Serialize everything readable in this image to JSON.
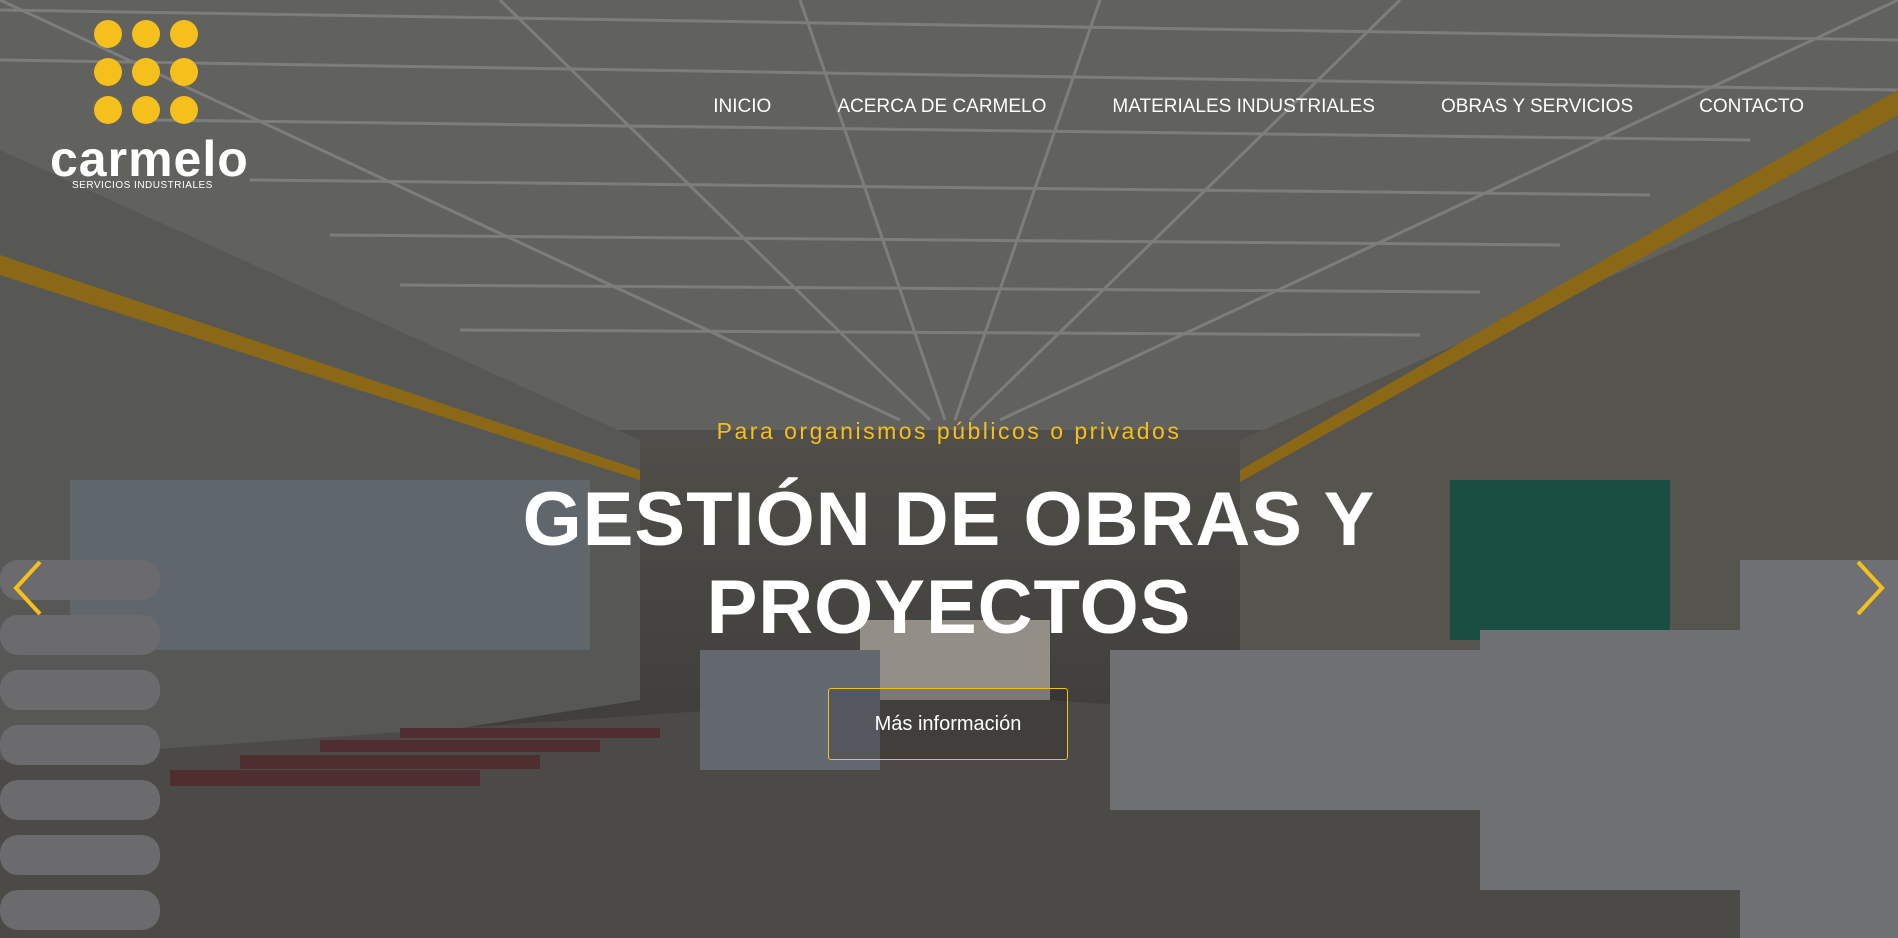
{
  "brand": {
    "name": "carmelo",
    "tagline": "SERVICIOS INDUSTRIALES",
    "accent": "#f5bf1c"
  },
  "nav": [
    {
      "label": "INICIO"
    },
    {
      "label": "ACERCA DE CARMELO"
    },
    {
      "label": "MATERIALES INDUSTRIALES"
    },
    {
      "label": "OBRAS Y SERVICIOS"
    },
    {
      "label": "CONTACTO"
    }
  ],
  "hero": {
    "subtitle": "Para organismos públicos o privados",
    "title_line1": "GESTIÓN DE OBRAS Y",
    "title_line2": "PROYECTOS",
    "cta_label": "Más información",
    "prev_icon": "chevron-left-icon",
    "next_icon": "chevron-right-icon",
    "background": "industrial-warehouse-photo"
  }
}
